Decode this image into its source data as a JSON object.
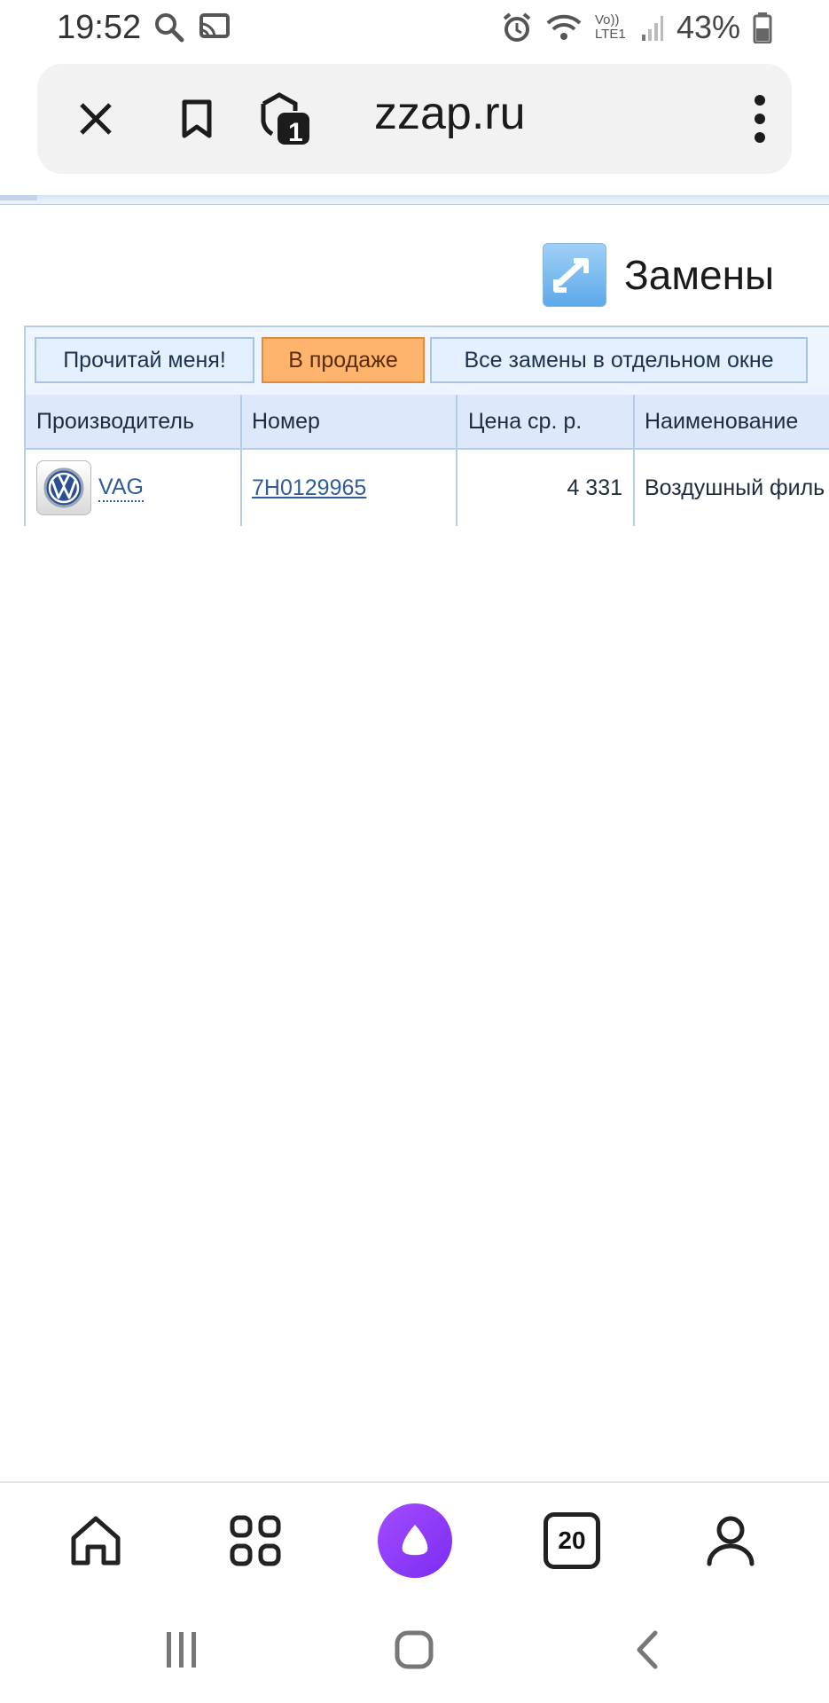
{
  "status": {
    "time": "19:52",
    "network_label": "Vo)) LTE1",
    "battery": "43%"
  },
  "browser": {
    "url": "zzap.ru",
    "tab_badge": "1",
    "icons": [
      "close-icon",
      "bookmark-icon",
      "tab-shield-icon",
      "more-vert-icon"
    ]
  },
  "section": {
    "title": "Замены",
    "icon": "swap-arrows-icon"
  },
  "tabs": [
    {
      "label": "Прочитай меня!",
      "active": false
    },
    {
      "label": "В продаже",
      "active": true
    },
    {
      "label": "Все замены в отдельном окне",
      "active": false
    }
  ],
  "table": {
    "columns": [
      "Производитель",
      "Номер",
      "Цена ср. р.",
      "Наименование"
    ],
    "rows": [
      {
        "manufacturer": "VAG",
        "manufacturer_logo": "volkswagen-logo-icon",
        "number": "7H0129965",
        "price": "4 331",
        "name": "Воздушный филь"
      }
    ]
  },
  "bottom_nav": {
    "items": [
      "home-icon",
      "apps-grid-icon",
      "alice-assistant-icon",
      "tabs-counter-icon",
      "profile-icon"
    ],
    "tabs_count": "20"
  },
  "system_nav": [
    "recents-icon",
    "home-circle-icon",
    "back-icon"
  ],
  "colors": {
    "active_tab": "#ffb46e",
    "table_border": "#b6cdea",
    "link": "#2f5c9a",
    "alice": "#8b3cf7"
  }
}
